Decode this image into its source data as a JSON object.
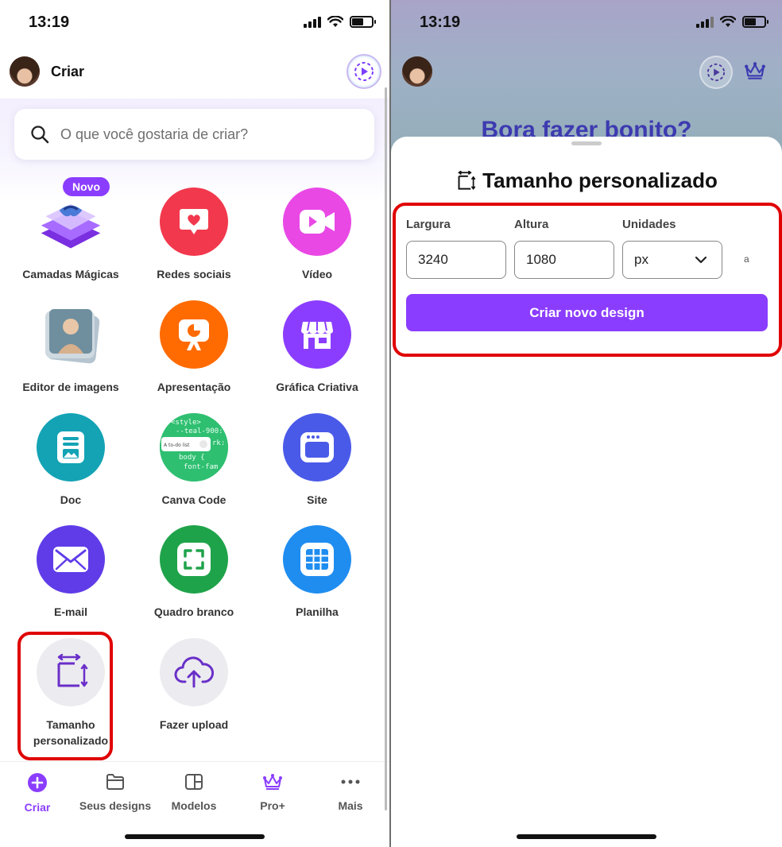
{
  "left": {
    "status": {
      "time": "13:19"
    },
    "header": {
      "title": "Criar"
    },
    "search": {
      "placeholder": "O que você gostaria de criar?"
    },
    "items": [
      {
        "label": "Camadas Mágicas",
        "badge": "Novo",
        "color": "#8b3dff",
        "icon": "magic-layers-icon"
      },
      {
        "label": "Redes sociais",
        "color": "#f2384d",
        "icon": "heart-bubble-icon"
      },
      {
        "label": "Vídeo",
        "color": "#e948e5",
        "icon": "video-camera-icon"
      },
      {
        "label": "Editor de imagens",
        "color": "#8fa9b8",
        "icon": "photo-stack-icon"
      },
      {
        "label": "Apresentação",
        "color": "#ff6b00",
        "icon": "presentation-icon"
      },
      {
        "label": "Gráfica Criativa",
        "color": "#8b3dff",
        "icon": "storefront-icon"
      },
      {
        "label": "Doc",
        "color": "#13a3b5",
        "icon": "document-icon"
      },
      {
        "label": "Canva Code",
        "color": "#2fbf71",
        "icon": "code-icon"
      },
      {
        "label": "Site",
        "color": "#4a5ae8",
        "icon": "website-icon"
      },
      {
        "label": "E-mail",
        "color": "#5f3ce8",
        "icon": "envelope-icon"
      },
      {
        "label": "Quadro branco",
        "color": "#1fa34a",
        "icon": "whiteboard-icon"
      },
      {
        "label": "Planilha",
        "color": "#1f8df0",
        "icon": "spreadsheet-icon"
      },
      {
        "label": "Tamanho personalizado",
        "color": "#ececf0",
        "icon": "custom-size-icon"
      },
      {
        "label": "Fazer upload",
        "color": "#ececf0",
        "icon": "cloud-upload-icon"
      }
    ],
    "nav": [
      {
        "label": "Criar",
        "icon": "plus-circle-icon",
        "active": true
      },
      {
        "label": "Seus designs",
        "icon": "folder-icon"
      },
      {
        "label": "Modelos",
        "icon": "templates-icon"
      },
      {
        "label": "Pro+",
        "icon": "crown-icon"
      },
      {
        "label": "Mais",
        "icon": "more-dots-icon"
      }
    ]
  },
  "right": {
    "status": {
      "time": "13:19"
    },
    "hero": "Bora fazer bonito?",
    "sheet": {
      "title": "Tamanho personalizado",
      "width_label": "Largura",
      "height_label": "Altura",
      "units_label": "Unidades",
      "width_value": "3240",
      "height_value": "1080",
      "units_value": "px",
      "lock_glyph": "a",
      "button": "Criar novo design"
    }
  },
  "colors": {
    "accent": "#8b3dff",
    "highlight": "#e00000"
  }
}
